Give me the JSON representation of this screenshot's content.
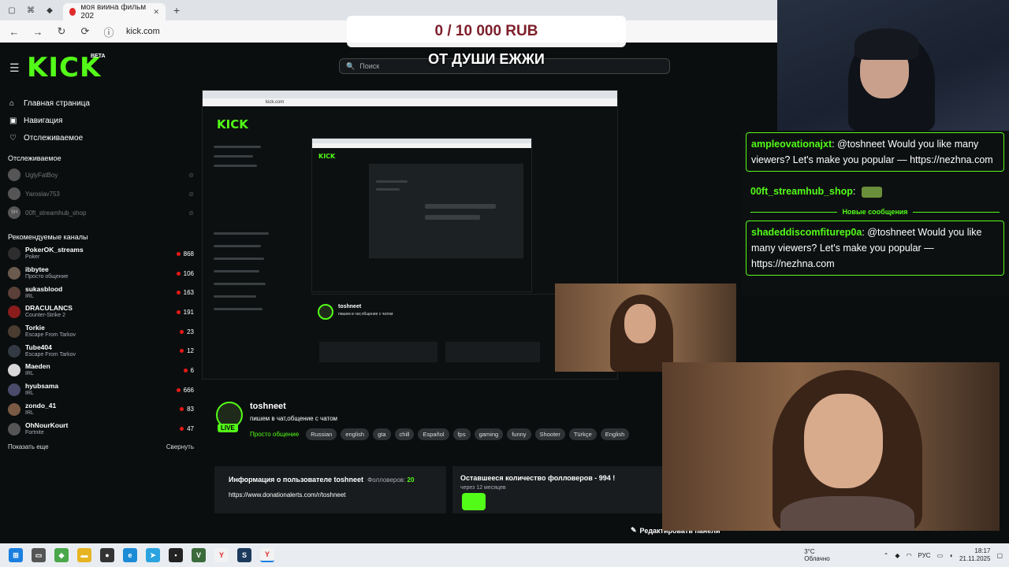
{
  "browser": {
    "tab_title": "моя виина фильм 202",
    "url": "kick.com"
  },
  "kick": {
    "logo": "KICK",
    "beta": "BETA",
    "search_placeholder": "Поиск",
    "nav": [
      {
        "label": "Главная страница",
        "icon": "home-icon"
      },
      {
        "label": "Навигация",
        "icon": "compass-icon"
      },
      {
        "label": "Отслеживаемое",
        "icon": "heart-icon"
      }
    ],
    "followed_header": "Отслеживаемое",
    "followed": [
      {
        "name": "UglyFatBoy"
      },
      {
        "name": "Yaroslav753"
      },
      {
        "name": "00ft_streamhub_shop",
        "avatar": "SH"
      }
    ],
    "recommended_header": "Рекомендуемые каналы",
    "recommended": [
      {
        "name": "PokerOK_streams",
        "category": "Poker",
        "viewers": "868",
        "color": "#2e2e2e"
      },
      {
        "name": "ibbytee",
        "category": "Просто общение",
        "viewers": "106",
        "color": "#6b5a4e"
      },
      {
        "name": "sukasblood",
        "category": "IRL",
        "viewers": "163",
        "color": "#5a4038"
      },
      {
        "name": "DRACULANCS",
        "category": "Counter-Strike 2",
        "viewers": "191",
        "color": "#8a1c1c"
      },
      {
        "name": "Torkie",
        "category": "Escape From Tarkov",
        "viewers": "23",
        "color": "#4a3c30"
      },
      {
        "name": "Tube404",
        "category": "Escape From Tarkov",
        "viewers": "12",
        "color": "#333a44"
      },
      {
        "name": "Maeden",
        "category": "IRL",
        "viewers": "6",
        "color": "#d8d8d8"
      },
      {
        "name": "hyubsama",
        "category": "IRL",
        "viewers": "666",
        "color": "#4a4a6a"
      },
      {
        "name": "zondo_41",
        "category": "IRL",
        "viewers": "83",
        "color": "#7a5a44"
      },
      {
        "name": "OhNourKourt",
        "category": "Fortnite",
        "viewers": "47",
        "color": "#555555"
      }
    ],
    "show_more": "Показать еще",
    "collapse": "Свернуть"
  },
  "stream": {
    "streamer": "toshneet",
    "live": "LIVE",
    "title": "пишем в чат,общение с чатом",
    "category": "Просто общение",
    "tags": [
      "Russian",
      "english",
      "gta",
      "chill",
      "Español",
      "fps",
      "gaming",
      "funny",
      "Shooter",
      "Türkçe",
      "English"
    ],
    "info_card_title": "Информация о пользователе toshneet",
    "followers_label": "Фолловеров:",
    "followers": "20",
    "donation_link": "https://www.donationalerts.com/r/toshneet",
    "goal_title": "Оставшееся количество фолловеров - 994 !",
    "goal_sub": "через 12 месяцев",
    "edit_panels": "Редактировать панели"
  },
  "overlay": {
    "donation": "0 / 10 000 RUB",
    "title": "ОТ ДУШИ ЕЖЖИ"
  },
  "chat": {
    "messages": [
      {
        "user": "ampleovationajxt",
        "text": ": @toshneet Would you like many viewers? Let's make you popular — https://nezhna.com"
      },
      {
        "user": "00ft_streamhub_shop",
        "text": ":"
      },
      {
        "user": "shadeddiscomfiturep0a",
        "text": ": @toshneet Would you like many viewers? Let's make you popular — https://nezhna.com"
      }
    ],
    "new_messages": "Новые сообщения"
  },
  "taskbar": {
    "weather_temp": "3°C",
    "weather_desc": "Облачно",
    "lang": "РУС",
    "time": "18:17",
    "date": "21.11.2025"
  }
}
